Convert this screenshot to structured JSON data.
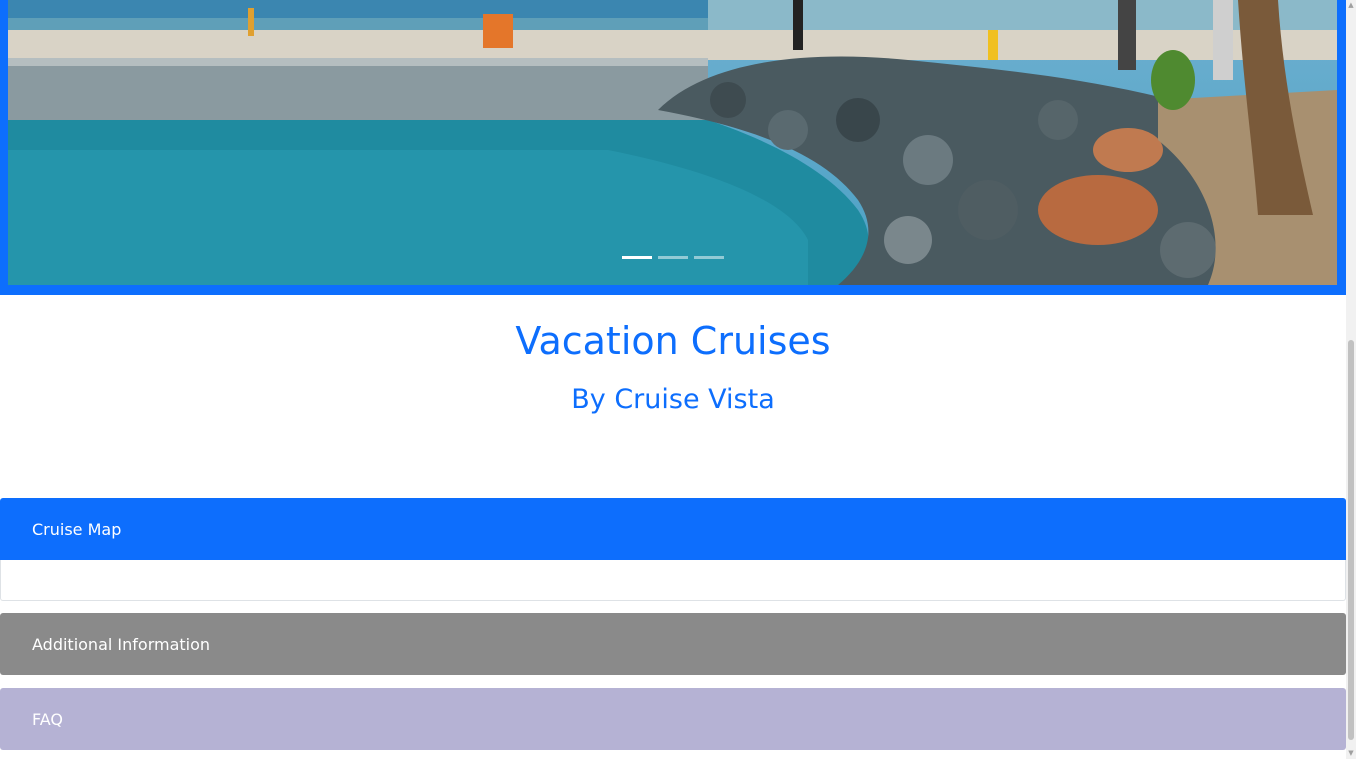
{
  "carousel": {
    "image_alt": "Harbor waterfront with rocks and palm trees",
    "slide_count": 3,
    "active_index": 0
  },
  "hero": {
    "title": "Vacation Cruises",
    "subtitle": "By Cruise Vista"
  },
  "accordion": {
    "items": [
      {
        "label": "Cruise Map",
        "expanded": true,
        "color": "#0d6efd"
      },
      {
        "label": "Additional Information",
        "expanded": false,
        "color": "#8a8a8a"
      },
      {
        "label": "FAQ",
        "expanded": false,
        "color": "#b5b2d4"
      }
    ]
  },
  "colors": {
    "primary": "#0d6efd",
    "secondary": "#8a8a8a",
    "lavender": "#b5b2d4"
  }
}
